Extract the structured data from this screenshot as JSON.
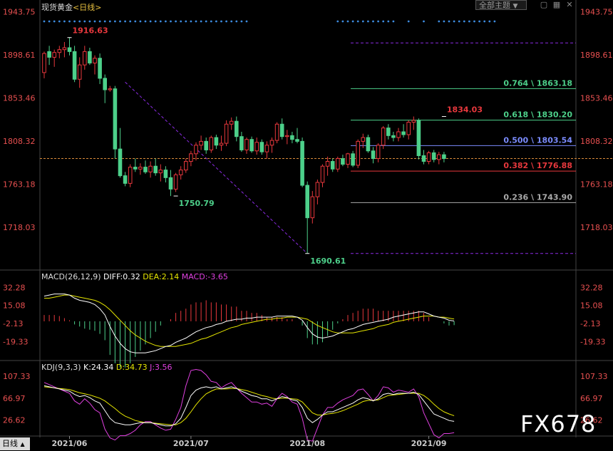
{
  "header": {
    "symbol": "现货黄金",
    "period": "<日线>",
    "theme_button": "全部主题",
    "theme_caret": "▼",
    "bottom_tab": "日线"
  },
  "watermark": "FX678",
  "colors": {
    "background": "#000000",
    "up": "#e8383d",
    "down": "#4dd08a",
    "price_axis": "#e85050",
    "dots": "#3d8ce0",
    "fib_line": "#8a2be2"
  },
  "chart_data": [
    {
      "type": "candlestick",
      "title": "",
      "y_ticks": [
        1943.75,
        1898.61,
        1853.46,
        1808.32,
        1763.18,
        1718.03
      ],
      "ylim": [
        1680,
        1950
      ],
      "x_labels": [
        "2021/06",
        "2021/07",
        "2021/08",
        "2021/09"
      ],
      "x_label_index": [
        5,
        29,
        52,
        76
      ],
      "reference_price": 1790,
      "annotations": [
        {
          "label": "1916.63",
          "index": 5,
          "price": 1916.63
        },
        {
          "label": "1750.79",
          "index": 26,
          "price": 1750.79
        },
        {
          "label": "1690.61",
          "index": 52,
          "price": 1690.61
        },
        {
          "label": "1834.03",
          "index": 79,
          "price": 1834.03
        }
      ],
      "fib_levels": [
        {
          "label": "",
          "price": 1911
        },
        {
          "label": "0.764 \\ 1863.18",
          "price": 1863.18
        },
        {
          "label": "0.618 \\ 1830.20",
          "price": 1830.2
        },
        {
          "label": "0.500 \\ 1803.54",
          "price": 1803.54
        },
        {
          "label": "0.382 \\ 1776.88",
          "price": 1776.88
        },
        {
          "label": "0.236 \\ 1743.90",
          "price": 1743.9
        },
        {
          "label": "",
          "price": 1690.61
        }
      ],
      "candles": [
        [
          1880,
          1902,
          1874,
          1900
        ],
        [
          1902,
          1908,
          1888,
          1896
        ],
        [
          1896,
          1904,
          1886,
          1901
        ],
        [
          1901,
          1908,
          1895,
          1904
        ],
        [
          1904,
          1912,
          1896,
          1906
        ],
        [
          1906,
          1916.63,
          1898,
          1902
        ],
        [
          1902,
          1908,
          1870,
          1873
        ],
        [
          1873,
          1896,
          1864,
          1888
        ],
        [
          1888,
          1908,
          1883,
          1902
        ],
        [
          1902,
          1906,
          1888,
          1890
        ],
        [
          1890,
          1898,
          1878,
          1895
        ],
        [
          1895,
          1900,
          1868,
          1874
        ],
        [
          1874,
          1878,
          1848,
          1862
        ],
        [
          1862,
          1866,
          1860,
          1863
        ],
        [
          1863,
          1866,
          1790,
          1800
        ],
        [
          1800,
          1822,
          1770,
          1772
        ],
        [
          1772,
          1776,
          1761,
          1764
        ],
        [
          1764,
          1784,
          1760,
          1781
        ],
        [
          1781,
          1790,
          1776,
          1779
        ],
        [
          1779,
          1785,
          1773,
          1781
        ],
        [
          1781,
          1788,
          1774,
          1776
        ],
        [
          1776,
          1787,
          1770,
          1782
        ],
        [
          1782,
          1790,
          1772,
          1775
        ],
        [
          1775,
          1784,
          1766,
          1778
        ],
        [
          1778,
          1782,
          1765,
          1770
        ],
        [
          1770,
          1778,
          1750.79,
          1758
        ],
        [
          1758,
          1775,
          1755,
          1773
        ],
        [
          1773,
          1782,
          1768,
          1778
        ],
        [
          1778,
          1790,
          1775,
          1787
        ],
        [
          1787,
          1798,
          1782,
          1795
        ],
        [
          1795,
          1807,
          1788,
          1804
        ],
        [
          1804,
          1814,
          1799,
          1808
        ],
        [
          1808,
          1812,
          1795,
          1799
        ],
        [
          1799,
          1814,
          1796,
          1812
        ],
        [
          1812,
          1815,
          1800,
          1804
        ],
        [
          1804,
          1814,
          1798,
          1806
        ],
        [
          1806,
          1830,
          1803,
          1826
        ],
        [
          1826,
          1833,
          1820,
          1829
        ],
        [
          1829,
          1834,
          1808,
          1813
        ],
        [
          1813,
          1818,
          1797,
          1799
        ],
        [
          1799,
          1812,
          1795,
          1810
        ],
        [
          1810,
          1813,
          1796,
          1798
        ],
        [
          1798,
          1812,
          1794,
          1807
        ],
        [
          1807,
          1810,
          1794,
          1797
        ],
        [
          1797,
          1808,
          1790,
          1804
        ],
        [
          1804,
          1812,
          1796,
          1809
        ],
        [
          1809,
          1828,
          1806,
          1826
        ],
        [
          1826,
          1832,
          1810,
          1813
        ],
        [
          1813,
          1820,
          1805,
          1814
        ],
        [
          1814,
          1818,
          1806,
          1810
        ],
        [
          1810,
          1822,
          1806,
          1808
        ],
        [
          1808,
          1812,
          1760,
          1762
        ],
        [
          1762,
          1766,
          1690.61,
          1728
        ],
        [
          1728,
          1756,
          1722,
          1750
        ],
        [
          1750,
          1768,
          1742,
          1765
        ],
        [
          1765,
          1784,
          1760,
          1782
        ],
        [
          1782,
          1792,
          1772,
          1787
        ],
        [
          1787,
          1790,
          1776,
          1779
        ],
        [
          1779,
          1792,
          1776,
          1790
        ],
        [
          1790,
          1794,
          1782,
          1784
        ],
        [
          1784,
          1796,
          1780,
          1795
        ],
        [
          1795,
          1798,
          1781,
          1783
        ],
        [
          1783,
          1810,
          1780,
          1808
        ],
        [
          1808,
          1816,
          1801,
          1812
        ],
        [
          1812,
          1815,
          1796,
          1798
        ],
        [
          1798,
          1802,
          1785,
          1790
        ],
        [
          1790,
          1806,
          1786,
          1804
        ],
        [
          1804,
          1824,
          1800,
          1822
        ],
        [
          1822,
          1826,
          1810,
          1814
        ],
        [
          1814,
          1818,
          1808,
          1812
        ],
        [
          1812,
          1822,
          1808,
          1818
        ],
        [
          1818,
          1826,
          1812,
          1815
        ],
        [
          1815,
          1830,
          1810,
          1828
        ],
        [
          1828,
          1834.03,
          1820,
          1830
        ],
        [
          1830,
          1832,
          1789,
          1793
        ],
        [
          1793,
          1799,
          1784,
          1787
        ],
        [
          1787,
          1798,
          1784,
          1796
        ],
        [
          1796,
          1799,
          1786,
          1789
        ],
        [
          1789,
          1797,
          1784,
          1794
        ],
        [
          1794,
          1797,
          1786,
          1790
        ]
      ]
    },
    {
      "type": "line",
      "title": "MACD(26,12,9)",
      "legend": [
        {
          "label": "DIFF:0.32",
          "color": "#ffffff"
        },
        {
          "label": "DEA:2.14",
          "color": "#e6e600"
        },
        {
          "label": "MACD:-3.65",
          "color": "#e040e0"
        }
      ],
      "y_ticks": [
        32.28,
        15.08,
        -2.13,
        -19.33
      ],
      "ylim": [
        -36,
        40
      ],
      "diff": [
        24,
        25,
        26,
        26,
        26,
        25,
        22,
        20,
        19,
        18,
        16,
        12,
        6,
        -5,
        -14,
        -21,
        -26,
        -29,
        -30,
        -30,
        -30,
        -29,
        -28,
        -26,
        -24,
        -23,
        -20,
        -18,
        -16,
        -13,
        -10,
        -8,
        -6,
        -5,
        -3,
        -2,
        0,
        1,
        2,
        2,
        3,
        3,
        4,
        4,
        4,
        4,
        5,
        5,
        5,
        5,
        4,
        1,
        -6,
        -12,
        -15,
        -16,
        -15,
        -14,
        -12,
        -10,
        -8,
        -7,
        -5,
        -3,
        -2,
        -1,
        0,
        1,
        2,
        4,
        5,
        6,
        7,
        8,
        9,
        9,
        7,
        5,
        4,
        3,
        1,
        0.32
      ],
      "dea": [
        22,
        22,
        23,
        24,
        25,
        25,
        24,
        23,
        22,
        21,
        20,
        18,
        15,
        11,
        6,
        1,
        -4,
        -9,
        -13,
        -16,
        -19,
        -21,
        -23,
        -24,
        -24,
        -24,
        -24,
        -23,
        -22,
        -21,
        -19,
        -17,
        -16,
        -14,
        -12,
        -10,
        -8,
        -6,
        -5,
        -3,
        -2,
        -1,
        0,
        1,
        2,
        2,
        3,
        3,
        4,
        4,
        4,
        3,
        2,
        -1,
        -4,
        -6,
        -8,
        -10,
        -11,
        -11,
        -11,
        -11,
        -10,
        -9,
        -8,
        -7,
        -5,
        -4,
        -3,
        -1,
        0,
        1,
        2,
        3,
        4,
        5,
        5,
        5,
        4,
        4,
        3,
        2.14
      ],
      "hist": [
        6,
        6,
        6,
        5,
        3,
        1,
        -3,
        -5,
        -7,
        -8,
        -9,
        -12,
        -18,
        -32,
        -40,
        -44,
        -44,
        -40,
        -34,
        -28,
        -22,
        -16,
        -10,
        -4,
        0,
        2,
        8,
        10,
        12,
        16,
        18,
        18,
        20,
        18,
        18,
        16,
        16,
        14,
        14,
        10,
        10,
        8,
        8,
        6,
        4,
        4,
        4,
        4,
        2,
        2,
        0,
        -4,
        -16,
        -22,
        -22,
        -20,
        -14,
        -8,
        -2,
        2,
        6,
        8,
        10,
        12,
        12,
        12,
        10,
        10,
        10,
        10,
        10,
        10,
        10,
        10,
        10,
        8,
        4,
        0,
        0,
        -2,
        -4,
        -3.65
      ]
    },
    {
      "type": "line",
      "title": "KDJ(9,3,3)",
      "legend": [
        {
          "label": "K:24.34",
          "color": "#ffffff"
        },
        {
          "label": "D:34.73",
          "color": "#e6e600"
        },
        {
          "label": "J:3.56",
          "color": "#e040e0"
        }
      ],
      "y_ticks": [
        107.33,
        66.97,
        26.62
      ],
      "ylim": [
        0,
        118
      ],
      "k": [
        90,
        88,
        86,
        84,
        82,
        80,
        74,
        70,
        72,
        68,
        62,
        58,
        44,
        30,
        22,
        20,
        18,
        18,
        20,
        22,
        22,
        22,
        20,
        18,
        16,
        16,
        20,
        30,
        50,
        72,
        82,
        86,
        88,
        86,
        88,
        84,
        86,
        88,
        85,
        80,
        76,
        72,
        70,
        66,
        66,
        62,
        66,
        70,
        68,
        64,
        62,
        50,
        30,
        22,
        28,
        36,
        42,
        42,
        46,
        50,
        54,
        58,
        64,
        68,
        66,
        62,
        66,
        74,
        76,
        74,
        76,
        76,
        76,
        78,
        74,
        62,
        50,
        38,
        34,
        30,
        26,
        24.34
      ],
      "d": [
        88,
        87,
        86,
        85,
        84,
        83,
        80,
        77,
        75,
        73,
        70,
        67,
        62,
        55,
        48,
        40,
        34,
        30,
        26,
        24,
        22,
        22,
        21,
        20,
        19,
        18,
        18,
        22,
        30,
        42,
        55,
        66,
        75,
        80,
        84,
        84,
        84,
        85,
        85,
        83,
        81,
        78,
        75,
        72,
        70,
        67,
        66,
        67,
        67,
        66,
        65,
        60,
        50,
        40,
        36,
        36,
        38,
        39,
        41,
        44,
        48,
        52,
        56,
        61,
        63,
        63,
        64,
        68,
        72,
        73,
        74,
        75,
        76,
        76,
        76,
        72,
        65,
        56,
        48,
        42,
        38,
        34.73
      ],
      "j": [
        96,
        92,
        88,
        84,
        80,
        76,
        62,
        56,
        66,
        58,
        46,
        40,
        10,
        -6,
        -10,
        -2,
        -2,
        2,
        8,
        18,
        24,
        24,
        18,
        12,
        8,
        10,
        28,
        50,
        90,
        118,
        120,
        118,
        110,
        98,
        96,
        86,
        92,
        96,
        86,
        76,
        68,
        60,
        60,
        56,
        58,
        52,
        66,
        76,
        70,
        60,
        56,
        30,
        -10,
        -12,
        12,
        36,
        50,
        50,
        58,
        64,
        68,
        72,
        82,
        84,
        74,
        62,
        72,
        88,
        86,
        78,
        82,
        80,
        78,
        84,
        70,
        40,
        20,
        0,
        -6,
        2,
        2,
        3.56
      ]
    }
  ]
}
